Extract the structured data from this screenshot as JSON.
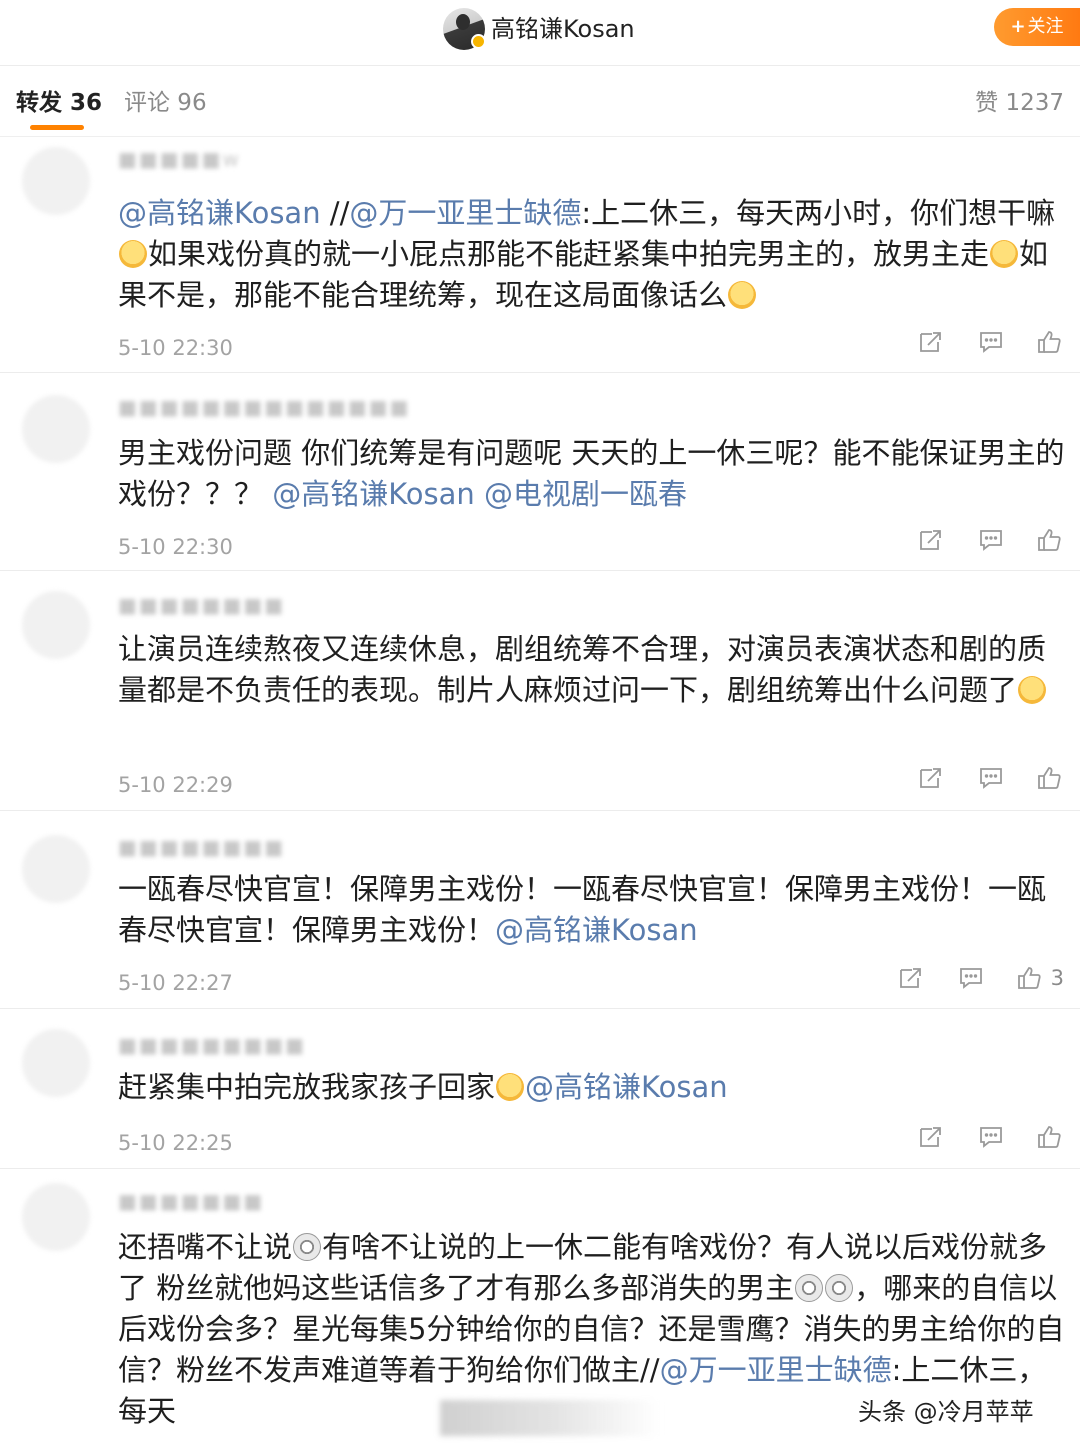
{
  "header": {
    "username": "高铭谦Kosan",
    "follow_label": "关注",
    "follow_plus": "+"
  },
  "tabs": {
    "repost": "转发 36",
    "comment": "评论 96",
    "like": "赞 1237"
  },
  "comments": [
    {
      "user": "",
      "segments": [
        {
          "t": "@高铭谦Kosan",
          "m": true
        },
        {
          "t": " //",
          "m": false
        },
        {
          "t": "@万一亚里士缺德",
          "m": true
        },
        {
          "t": ":上二休三，每天两小时，你们想干嘛",
          "m": false
        },
        {
          "e": "smile"
        },
        {
          "t": "如果戏份真的就一小屁点那能不能赶紧集中拍完男主的，放男主走",
          "m": false
        },
        {
          "e": "smile"
        },
        {
          "t": "如果不是，那能不能合理统筹，现在这局面像话么",
          "m": false
        },
        {
          "e": "smile"
        }
      ],
      "time": "5-10 22:30",
      "likes": ""
    },
    {
      "user": "",
      "segments": [
        {
          "t": "男主戏份问题 你们统筹是有问题呢 天天的上一休三呢？能不能保证男主的戏份？？？ ",
          "m": false
        },
        {
          "t": "@高铭谦Kosan",
          "m": true
        },
        {
          "t": " ",
          "m": false
        },
        {
          "t": "@电视剧一瓯春",
          "m": true
        }
      ],
      "time": "5-10 22:30",
      "likes": ""
    },
    {
      "user": "",
      "segments": [
        {
          "t": "让演员连续熬夜又连续休息，剧组统筹不合理，对演员表演状态和剧的质量都是不负责任的表现。制片人麻烦过问一下，剧组统筹出什么问题了",
          "m": false
        },
        {
          "e": "smile"
        }
      ],
      "time": "5-10 22:29",
      "likes": ""
    },
    {
      "user": "",
      "segments": [
        {
          "t": "一瓯春尽快官宣！保障男主戏份！一瓯春尽快官宣！保障男主戏份！一瓯春尽快官宣！保障男主戏份！",
          "m": false
        },
        {
          "t": "@高铭谦Kosan",
          "m": true
        }
      ],
      "time": "5-10 22:27",
      "likes": "3"
    },
    {
      "user": "",
      "segments": [
        {
          "t": "赶紧集中拍完放我家孩子回家",
          "m": false
        },
        {
          "e": "smile"
        },
        {
          "t": "@高铭谦Kosan",
          "m": true
        }
      ],
      "time": "5-10 22:25",
      "likes": ""
    },
    {
      "user": "",
      "segments": [
        {
          "t": "还捂嘴不让说",
          "m": false
        },
        {
          "e": "shock"
        },
        {
          "t": "有啥不让说的上一休二能有啥戏份？有人说以后戏份就多了 粉丝就他妈这些话信多了才有那么多部消失的男主",
          "m": false
        },
        {
          "e": "shock"
        },
        {
          "e": "shock"
        },
        {
          "t": "，哪来的自信以后戏份会多？星光每集5分钟给你的自信？还是雪鹰？消失的男主给你的自信？粉丝不发声难道等着于狗给你们做主",
          "m": false
        },
        {
          "t": "//",
          "m": false
        },
        {
          "t": "@万一亚里士缺德",
          "m": true
        },
        {
          "t": ":上二休三，每天",
          "m": false
        }
      ],
      "time": "",
      "likes": ""
    }
  ],
  "watermark": "头条 @冷月苹苹",
  "colors": {
    "accent": "#ff8200",
    "mention": "#5a7cad",
    "follow_bg": "#ff8a1f"
  },
  "icons": [
    "repost-icon",
    "comment-icon",
    "like-icon"
  ]
}
